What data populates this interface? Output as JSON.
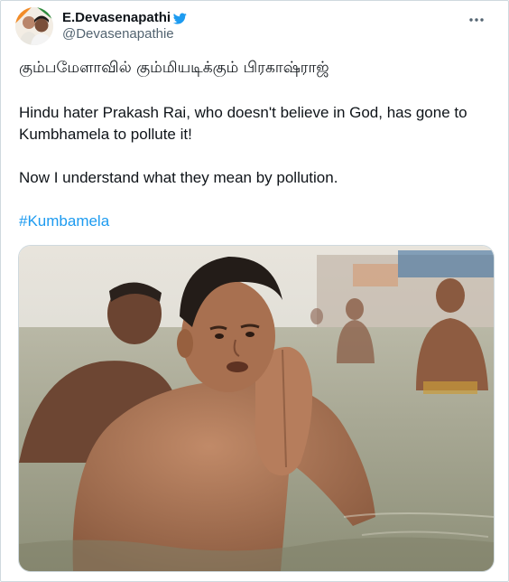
{
  "tweet": {
    "display_name": "E.Devasenapathi",
    "handle": "@Devasenapathie",
    "tamil_line": "கும்பமேளாவில் கும்மியடிக்கும் பிரகாஷ்ராஜ்",
    "paragraph_1": "Hindu hater Prakash Rai, who doesn't believe in God, has gone to Kumbhamela to pollute it!",
    "paragraph_2": "Now I understand what they mean by pollution.",
    "hashtag": "#Kumbamela"
  },
  "icons": {
    "verified": "twitter-bird-icon",
    "more": "more-options-icon"
  },
  "colors": {
    "link": "#1d9bf0",
    "secondary_text": "#536471",
    "border": "#cfd9de"
  }
}
